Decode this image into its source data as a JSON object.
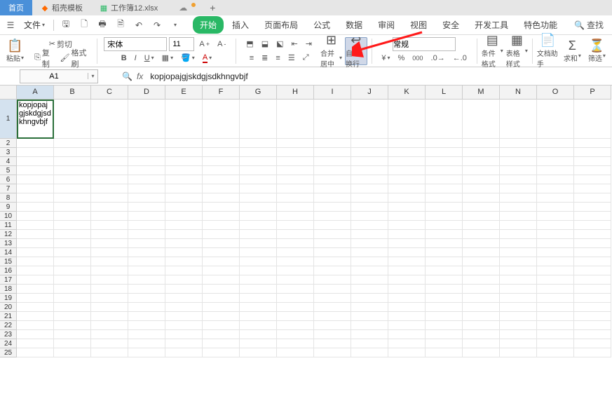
{
  "tabs": {
    "items": [
      {
        "label": "首页",
        "icon": "home",
        "active": true
      },
      {
        "label": "稻壳模板",
        "icon": "rice",
        "color": "#ff6a00"
      },
      {
        "label": "工作簿12.xlsx",
        "icon": "sheet",
        "color": "#29b865"
      }
    ],
    "add_label": "+"
  },
  "menu": {
    "file_label": "文件",
    "tabs": [
      {
        "label": "开始",
        "active": true
      },
      {
        "label": "插入"
      },
      {
        "label": "页面布局"
      },
      {
        "label": "公式"
      },
      {
        "label": "数据"
      },
      {
        "label": "审阅"
      },
      {
        "label": "视图"
      },
      {
        "label": "安全"
      },
      {
        "label": "开发工具"
      },
      {
        "label": "特色功能"
      }
    ],
    "search_label": "查找"
  },
  "ribbon": {
    "paste": "粘贴",
    "cut": "剪切",
    "copy": "复制",
    "format_painter": "格式刷",
    "font_name": "宋体",
    "font_size": "11",
    "merge_center": "合并居中",
    "wrap_text": "自动换行",
    "number_format": "常规",
    "cond_format": "条件格式",
    "table_style": "表格样式",
    "doc_assistant": "文档助手",
    "sum": "求和",
    "filter": "筛选"
  },
  "namebox": "A1",
  "formula": "kopjopajgjskdgjsdkhngvbjf",
  "grid": {
    "columns": [
      "A",
      "B",
      "C",
      "D",
      "E",
      "F",
      "G",
      "H",
      "I",
      "J",
      "K",
      "L",
      "M",
      "N",
      "O",
      "P"
    ],
    "rows": 25,
    "active_col": 0,
    "active_row": 0,
    "row1_height": 56,
    "cell_a1": "kopjopajgjskdgjsdkhngvbjf"
  }
}
